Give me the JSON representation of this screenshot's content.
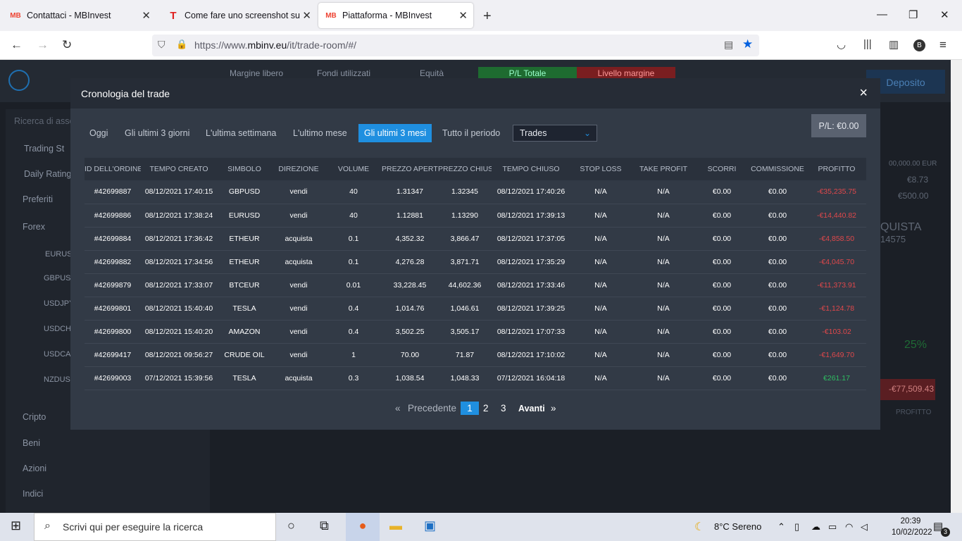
{
  "browser": {
    "tabs": [
      {
        "label": "Contattaci - MBInvest",
        "favicon": "MB"
      },
      {
        "label": "Come fare uno screenshot su un",
        "favicon": "T"
      },
      {
        "label": "Piattaforma - MBInvest",
        "favicon": "MB"
      }
    ],
    "new_tab_icon": "+",
    "url": "https://www.",
    "url_domain": "mbinv.eu",
    "url_path": "/it/trade-room/#/",
    "profile_initial": "B"
  },
  "background": {
    "header": {
      "margine": "Margine libero",
      "fondi": "Fondi utilizzati",
      "equita": "Equità",
      "pl_totale": "P/L Totale",
      "livello": "Livello margine",
      "deposito": "Deposito"
    },
    "search_placeholder": "Ricerca di asset",
    "sidebar": [
      "Trading St",
      "Daily Rating",
      "Preferiti",
      "Forex",
      "EURUS",
      "GBPUSD",
      "USDJPY",
      "USDCHF",
      "USDCAD",
      "NZDUSD",
      "Cripto",
      "Beni",
      "Azioni",
      "Indici"
    ],
    "right_values": [
      "00,000.00 EUR",
      "€8.73",
      "€500.00",
      "QUISTA",
      "14575",
      "25%",
      "-€77,509.43",
      "PROFITTO"
    ]
  },
  "modal": {
    "title": "Cronologia del trade",
    "close_icon": "×",
    "pl_label": "P/L:",
    "pl_value": "€0.00",
    "filters": [
      "Oggi",
      "Gli ultimi 3 giorni",
      "L'ultima settimana",
      "L'ultimo mese",
      "Gli ultimi 3 mesi",
      "Tutto il periodo"
    ],
    "active_filter": "Gli ultimi 3 mesi",
    "select_value": "Trades",
    "columns": [
      "ID DELL'ORDINE",
      "TEMPO CREATO",
      "SIMBOLO",
      "DIREZIONE",
      "VOLUME",
      "PREZZO APERTURA",
      "PREZZO CHIUSURA",
      "TEMPO CHIUSO",
      "STOP LOSS",
      "TAKE PROFIT",
      "SCORRI",
      "COMMISSIONE",
      "PROFITTO"
    ],
    "rows": [
      [
        "#42699887",
        "08/12/2021 17:40:15",
        "GBPUSD",
        "vendi",
        "40",
        "1.31347",
        "1.32345",
        "08/12/2021 17:40:26",
        "N/A",
        "N/A",
        "€0.00",
        "€0.00",
        "-€35,235.75"
      ],
      [
        "#42699886",
        "08/12/2021 17:38:24",
        "EURUSD",
        "vendi",
        "40",
        "1.12881",
        "1.13290",
        "08/12/2021 17:39:13",
        "N/A",
        "N/A",
        "€0.00",
        "€0.00",
        "-€14,440.82"
      ],
      [
        "#42699884",
        "08/12/2021 17:36:42",
        "ETHEUR",
        "acquista",
        "0.1",
        "4,352.32",
        "3,866.47",
        "08/12/2021 17:37:05",
        "N/A",
        "N/A",
        "€0.00",
        "€0.00",
        "-€4,858.50"
      ],
      [
        "#42699882",
        "08/12/2021 17:34:56",
        "ETHEUR",
        "acquista",
        "0.1",
        "4,276.28",
        "3,871.71",
        "08/12/2021 17:35:29",
        "N/A",
        "N/A",
        "€0.00",
        "€0.00",
        "-€4,045.70"
      ],
      [
        "#42699879",
        "08/12/2021 17:33:07",
        "BTCEUR",
        "vendi",
        "0.01",
        "33,228.45",
        "44,602.36",
        "08/12/2021 17:33:46",
        "N/A",
        "N/A",
        "€0.00",
        "€0.00",
        "-€11,373.91"
      ],
      [
        "#42699801",
        "08/12/2021 15:40:40",
        "TESLA",
        "vendi",
        "0.4",
        "1,014.76",
        "1,046.61",
        "08/12/2021 17:39:25",
        "N/A",
        "N/A",
        "€0.00",
        "€0.00",
        "-€1,124.78"
      ],
      [
        "#42699800",
        "08/12/2021 15:40:20",
        "AMAZON",
        "vendi",
        "0.4",
        "3,502.25",
        "3,505.17",
        "08/12/2021 17:07:33",
        "N/A",
        "N/A",
        "€0.00",
        "€0.00",
        "-€103.02"
      ],
      [
        "#42699417",
        "08/12/2021 09:56:27",
        "CRUDE OIL",
        "vendi",
        "1",
        "70.00",
        "71.87",
        "08/12/2021 17:10:02",
        "N/A",
        "N/A",
        "€0.00",
        "€0.00",
        "-€1,649.70"
      ],
      [
        "#42699003",
        "07/12/2021 15:39:56",
        "TESLA",
        "acquista",
        "0.3",
        "1,038.54",
        "1,048.33",
        "07/12/2021 16:04:18",
        "N/A",
        "N/A",
        "€0.00",
        "€0.00",
        "€261.17"
      ]
    ],
    "pager": {
      "first": "«",
      "prev": "Precedente",
      "pages": [
        "1",
        "2",
        "3"
      ],
      "current": "1",
      "next": "Avanti",
      "last": "»"
    }
  },
  "taskbar": {
    "search_placeholder": "Scrivi qui per eseguire la ricerca",
    "weather": "8°C  Sereno",
    "time": "20:39",
    "date": "10/02/2022",
    "notifications": "3"
  },
  "colors": {
    "accent": "#1f8fe0",
    "negative": "#e0484b",
    "positive": "#2ebd61"
  }
}
